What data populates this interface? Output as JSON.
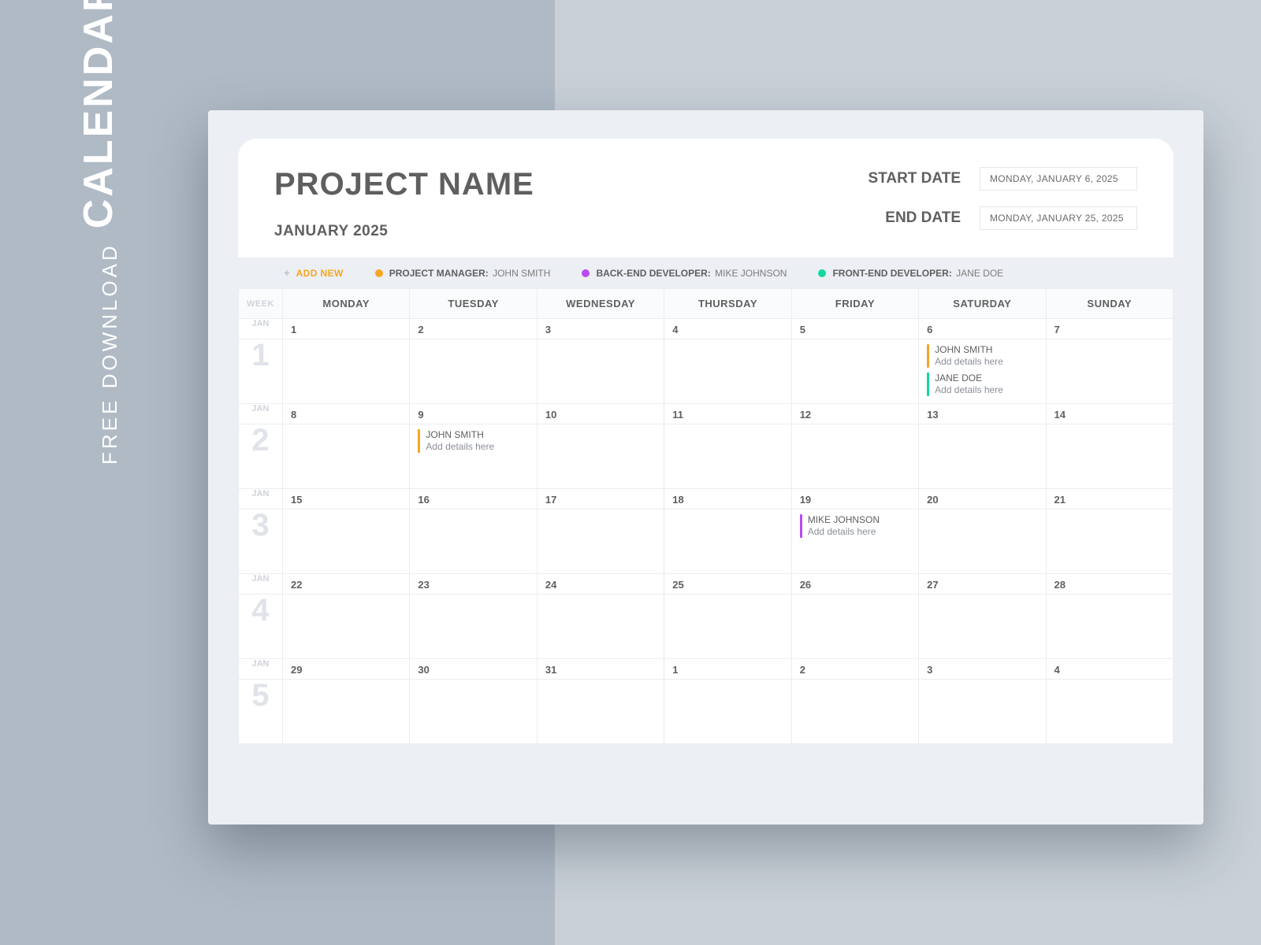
{
  "sideLabels": {
    "sub": "FREE DOWNLOAD",
    "main": "CALENDAR TEMPLATE"
  },
  "header": {
    "title": "PROJECT NAME",
    "month": "JANUARY 2025",
    "startLabel": "START DATE",
    "startValue": "MONDAY, JANUARY 6, 2025",
    "endLabel": "END DATE",
    "endValue": "MONDAY, JANUARY 25, 2025"
  },
  "legend": {
    "addIcon": "+",
    "addLabel": "ADD NEW",
    "items": [
      {
        "color": "#f5a623",
        "role": "PROJECT MANAGER:",
        "name": "JOHN SMITH"
      },
      {
        "color": "#b84af0",
        "role": "BACK-END DEVELOPER:",
        "name": "MIKE JOHNSON"
      },
      {
        "color": "#13d6a2",
        "role": "FRONT-END DEVELOPER:",
        "name": "JANE DOE"
      }
    ]
  },
  "calendar": {
    "weekHeader": "WEEK",
    "days": [
      "MONDAY",
      "TUESDAY",
      "WEDNESDAY",
      "THURSDAY",
      "FRIDAY",
      "SATURDAY",
      "SUNDAY"
    ],
    "monthAbbr": "JAN",
    "weeks": [
      {
        "num": "1",
        "dates": [
          "1",
          "2",
          "3",
          "4",
          "5",
          "6",
          "7"
        ],
        "cells": [
          [],
          [],
          [],
          [],
          [],
          [
            {
              "color": "#f5a623",
              "name": "JOHN SMITH",
              "detail": "Add details here"
            },
            {
              "color": "#13d6a2",
              "name": "JANE DOE",
              "detail": "Add details here"
            }
          ],
          []
        ]
      },
      {
        "num": "2",
        "dates": [
          "8",
          "9",
          "10",
          "11",
          "12",
          "13",
          "14"
        ],
        "cells": [
          [],
          [
            {
              "color": "#f5a623",
              "name": "JOHN SMITH",
              "detail": "Add details here"
            }
          ],
          [],
          [],
          [],
          [],
          []
        ]
      },
      {
        "num": "3",
        "dates": [
          "15",
          "16",
          "17",
          "18",
          "19",
          "20",
          "21"
        ],
        "cells": [
          [],
          [],
          [],
          [],
          [
            {
              "color": "#b84af0",
              "name": "MIKE JOHNSON",
              "detail": "Add details here"
            }
          ],
          [],
          []
        ]
      },
      {
        "num": "4",
        "dates": [
          "22",
          "23",
          "24",
          "25",
          "26",
          "27",
          "28"
        ],
        "cells": [
          [],
          [],
          [],
          [],
          [],
          [],
          []
        ]
      },
      {
        "num": "5",
        "dates": [
          "29",
          "30",
          "31",
          "1",
          "2",
          "3",
          "4"
        ],
        "cells": [
          [],
          [],
          [],
          [],
          [],
          [],
          []
        ]
      }
    ]
  }
}
